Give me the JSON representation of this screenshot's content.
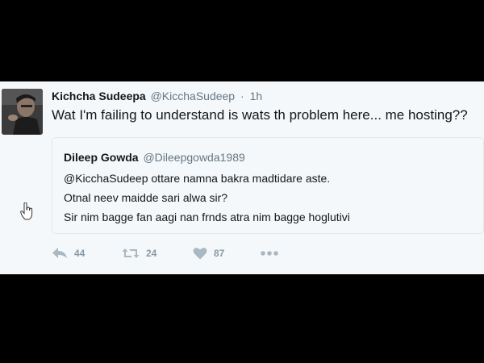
{
  "tweet": {
    "author_name": "Kichcha Sudeepa",
    "author_handle": "@KicchaSudeep",
    "separator": "·",
    "time": "1h",
    "text": "Wat I'm failing to understand is wats th problem here... me hosting??"
  },
  "quoted_tweet": {
    "author_name": "Dileep Gowda",
    "author_handle": "@Dileepgowda1989",
    "lines": [
      "@KicchaSudeep ottare namna bakra madtidare aste.",
      "Otnal neev maidde sari alwa sir?",
      "Sir nim bagge fan aagi nan frnds atra nim bagge hoglutivi"
    ]
  },
  "actions": {
    "reply": {
      "icon": "reply-icon",
      "count": "44"
    },
    "retweet": {
      "icon": "retweet-icon",
      "count": "24"
    },
    "like": {
      "icon": "heart-icon",
      "count": "87"
    },
    "more": {
      "icon": "more-icon"
    }
  },
  "colors": {
    "background": "#000000",
    "card": "#f5f8fa",
    "text": "#14171a",
    "muted": "#657786",
    "icon": "#aab8c2",
    "border": "#e1e8ed"
  }
}
